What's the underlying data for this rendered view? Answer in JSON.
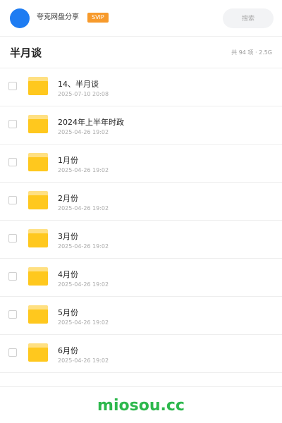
{
  "header": {
    "username": "夸克网盘分享",
    "badge": "SVIP",
    "search_placeholder": "搜索",
    "colors": {
      "avatar": "#1e7cf2",
      "badge": "#f79a2b"
    }
  },
  "folder": {
    "title": "半月谈",
    "summary": "共 94 项 · 2.5G"
  },
  "items": [
    {
      "name": "14、半月谈",
      "date": "2025-07-10 20:08",
      "icon": "folder-icon"
    },
    {
      "name": "2024年上半年时政",
      "date": "2025-04-26 19:02",
      "icon": "folder-icon"
    },
    {
      "name": "1月份",
      "date": "2025-04-26 19:02",
      "icon": "folder-icon"
    },
    {
      "name": "2月份",
      "date": "2025-04-26 19:02",
      "icon": "folder-icon"
    },
    {
      "name": "3月份",
      "date": "2025-04-26 19:02",
      "icon": "folder-icon"
    },
    {
      "name": "4月份",
      "date": "2025-04-26 19:02",
      "icon": "folder-icon"
    },
    {
      "name": "5月份",
      "date": "2025-04-26 19:02",
      "icon": "folder-icon"
    },
    {
      "name": "6月份",
      "date": "2025-04-26 19:02",
      "icon": "folder-icon"
    }
  ],
  "footer": {
    "brand": "miosou.cc",
    "brand_color": "#2db84d"
  }
}
